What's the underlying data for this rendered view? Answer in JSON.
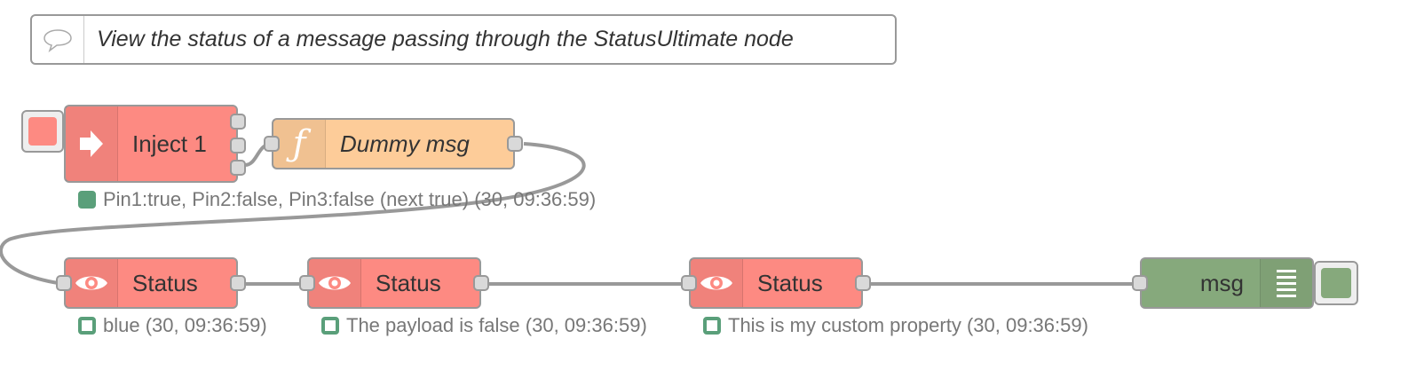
{
  "comment": {
    "text": "View the status of a message passing through the StatusUltimate node",
    "icon": "speech-bubble-icon"
  },
  "colors": {
    "inject": "#fd8a82",
    "function": "#fdcc99",
    "status": "#fd8a82",
    "debug": "#86a97c",
    "status_dot": "#5a9f7a",
    "wire": "#999999"
  },
  "nodes": {
    "inject": {
      "label": "Inject 1",
      "icon": "inject-arrow-icon",
      "status": "Pin1:true, Pin2:false, Pin3:false (next true) (30, 09:36:59)"
    },
    "function": {
      "label": "Dummy msg",
      "icon": "function-icon"
    },
    "status1": {
      "label": "Status",
      "icon": "eye-icon",
      "status": "blue (30, 09:36:59)"
    },
    "status2": {
      "label": "Status",
      "icon": "eye-icon",
      "status": "The payload is false (30, 09:36:59)"
    },
    "status3": {
      "label": "Status",
      "icon": "eye-icon",
      "status": "This is my custom property (30, 09:36:59)"
    },
    "debug": {
      "label": "msg",
      "icon": "debug-list-icon"
    }
  }
}
